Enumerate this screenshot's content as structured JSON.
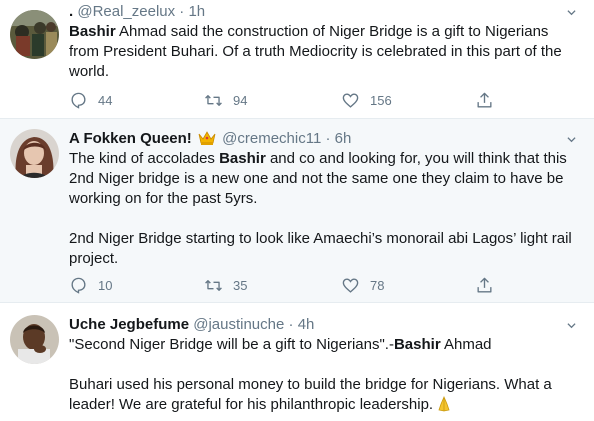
{
  "tweets": [
    {
      "name": ".",
      "handle": "@Real_zeelux",
      "sep": "·",
      "time": "1h",
      "text_lines": [
        [
          {
            "b": "Bashir"
          },
          {
            "t": " Ahmad said the construction of Niger Bridge is a gift to Nigerians"
          }
        ],
        [
          {
            "t": "from President Buhari. Of a truth Mediocrity is celebrated in this part of the"
          }
        ],
        [
          {
            "t": "world."
          }
        ]
      ],
      "replies": "44",
      "retweets": "94",
      "likes": "156"
    },
    {
      "name": "A Fokken Queen!",
      "handle": "@cremechic11",
      "sep": "·",
      "time": "6h",
      "text_lines": [
        [
          {
            "t": "The kind of accolades "
          },
          {
            "b": "Bashir"
          },
          {
            "t": " and co and looking for, you will think that this"
          }
        ],
        [
          {
            "t": "2nd Niger bridge is a new one and not the same one they claim to have be"
          }
        ],
        [
          {
            "t": "working on for the past 5yrs."
          }
        ],
        [
          {
            "t": ""
          }
        ],
        [
          {
            "t": "2nd Niger Bridge starting to look like Amaechi’s monorail abi Lagos’ light rail"
          }
        ],
        [
          {
            "t": "project."
          }
        ]
      ],
      "replies": "10",
      "retweets": "35",
      "likes": "78"
    },
    {
      "name": "Uche Jegbefume",
      "handle": "@jaustinuche",
      "sep": "·",
      "time": "4h",
      "text_lines": [
        [
          {
            "t": "\"Second Niger Bridge will be a gift to Nigerians\".-"
          },
          {
            "b": "Bashir"
          },
          {
            "t": " Ahmad"
          }
        ],
        [
          {
            "t": ""
          }
        ],
        [
          {
            "t": "Buhari used his personal money to build the bridge for Nigerians. What a"
          }
        ],
        [
          {
            "t": "leader! We are grateful for his philanthropic leadership."
          }
        ]
      ]
    }
  ],
  "icons": {
    "reply": "reply-icon",
    "retweet": "retweet-icon",
    "like": "heart-icon",
    "share": "share-icon",
    "caret": "chevron-down-icon",
    "crown": "crown-emoji-icon",
    "pray": "folded-hands-emoji-icon"
  },
  "colors": {
    "text": "#14171a",
    "muted": "#657786",
    "highlight_bg": "#f5f8fa",
    "divider": "#e6ecf0"
  }
}
